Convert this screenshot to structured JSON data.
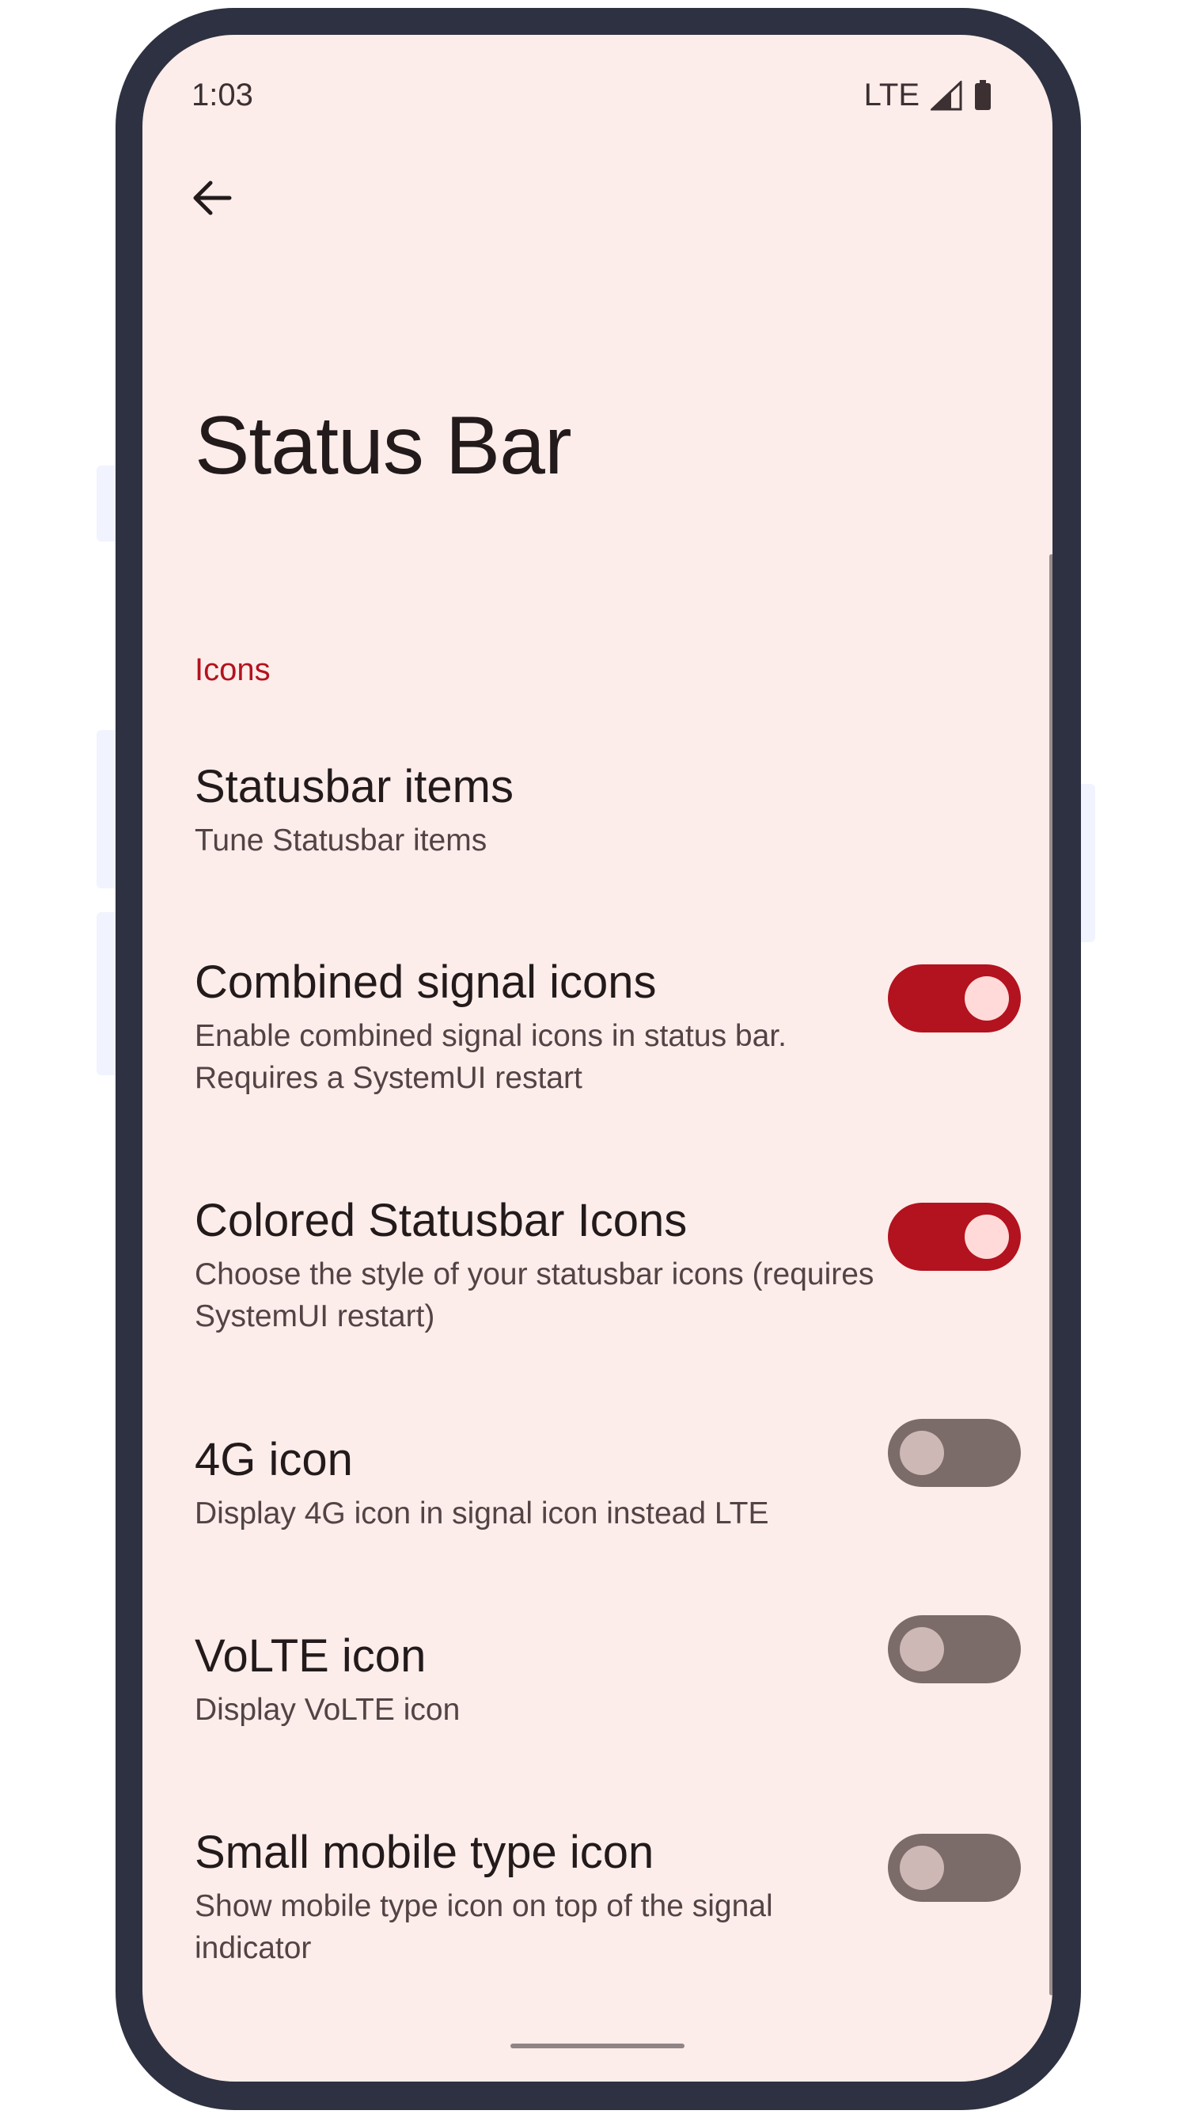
{
  "status_bar": {
    "time": "1:03",
    "network_label": "LTE",
    "signal_icon": "signal-icon",
    "battery_icon": "battery-icon"
  },
  "toolbar": {
    "back_icon": "arrow-back-icon"
  },
  "page": {
    "title": "Status Bar"
  },
  "section": {
    "header": "Icons"
  },
  "preferences": [
    {
      "title": "Statusbar items",
      "summary": "Tune Statusbar items"
    },
    {
      "title": "Combined signal icons",
      "summary": "Enable combined signal icons in status bar. Requires a SystemUI restart",
      "checked": true
    },
    {
      "title": "Colored Statusbar Icons",
      "summary": "Choose the style of your statusbar icons (requires SystemUI restart)",
      "checked": true
    },
    {
      "title": "4G icon",
      "summary": "Display 4G icon in signal icon instead LTE",
      "checked": false
    },
    {
      "title": "VoLTE icon",
      "summary": "Display VoLTE icon",
      "checked": false
    },
    {
      "title": "Small mobile type icon",
      "summary": "Show mobile type icon on top of the signal indicator",
      "checked": false
    }
  ],
  "colors": {
    "accent": "#b3121f",
    "background": "#fcedea",
    "frame": "#2e3141",
    "switch_off_track": "#7b6b69"
  }
}
